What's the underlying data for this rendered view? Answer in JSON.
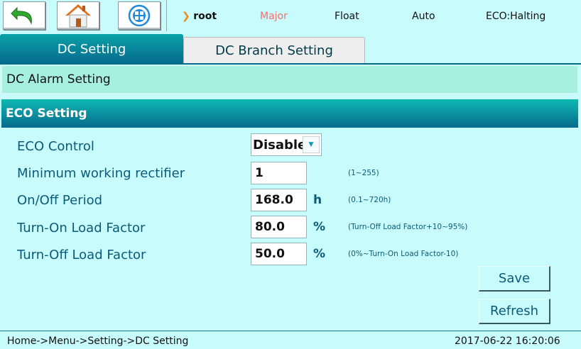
{
  "status": {
    "path_label": "root",
    "alarm": "Major",
    "mode": "Float",
    "control": "Auto",
    "eco": "ECO:Halting"
  },
  "tabs": [
    "DC Setting",
    "DC Branch Setting"
  ],
  "sections": {
    "alarm_title": "DC Alarm Setting",
    "eco_title": "ECO Setting"
  },
  "fields": {
    "eco_control": {
      "label": "ECO Control",
      "value": "Disable"
    },
    "min_rect": {
      "label": "Minimum working rectifier",
      "value": "1",
      "range": "(1~255)"
    },
    "period": {
      "label": "On/Off Period",
      "value": "168.0",
      "unit": "h",
      "range": "(0.1~720h)"
    },
    "turn_on": {
      "label": "Turn-On Load Factor",
      "value": "80.0",
      "unit": "%",
      "range": "(Turn-Off Load Factor+10~95%)"
    },
    "turn_off": {
      "label": "Turn-Off Load Factor",
      "value": "50.0",
      "unit": "%",
      "range": "(0%~Turn-On Load Factor-10)"
    }
  },
  "buttons": {
    "save": "Save",
    "refresh": "Refresh"
  },
  "footer": {
    "breadcrumb": "Home->Menu->Setting->DC Setting",
    "datetime": "2017-06-22 16:20:06"
  },
  "colors": {
    "accent": "#066a8c",
    "alarm": "#f07070",
    "background": "#c8fbfb"
  }
}
